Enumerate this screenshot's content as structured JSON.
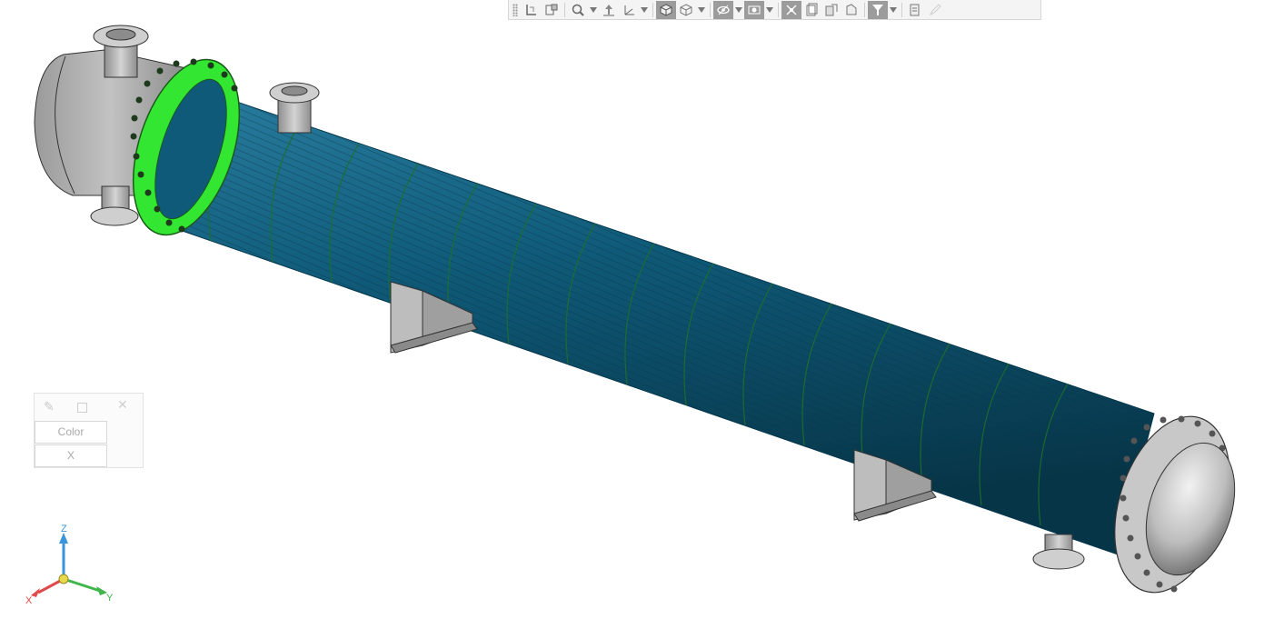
{
  "toolbar": {
    "items": [
      {
        "icon": "previous-view-icon"
      },
      {
        "icon": "section-view-icon"
      },
      {
        "icon": "zoom-to-area-icon",
        "dropdown": true
      },
      {
        "icon": "view-orientation-icon",
        "dropdown": true
      },
      {
        "icon": "display-style-icon",
        "dropdown": true
      },
      {
        "icon": "hide-show-items-icon",
        "dropdown": true
      },
      {
        "icon": "edit-appearance-icon",
        "dropdown": true
      },
      {
        "icon": "apply-scene-icon"
      },
      {
        "icon": "view-settings-icon",
        "dropdown": true
      },
      {
        "icon": "filter-icon",
        "dropdown": true
      },
      {
        "icon": "selection-filter-icon"
      }
    ]
  },
  "colors": {
    "tube_bundle": "#0f5a78",
    "highlight_flange": "#32e632",
    "shell_gray": "#bdbdbd",
    "triad_x": "#e04a4a",
    "triad_y": "#3fb54a",
    "triad_z": "#3a96d8"
  },
  "mini_panel": {
    "field_1": "Color",
    "field_2": "X"
  },
  "triad": {
    "x_label": "X",
    "y_label": "Y",
    "z_label": "Z"
  }
}
